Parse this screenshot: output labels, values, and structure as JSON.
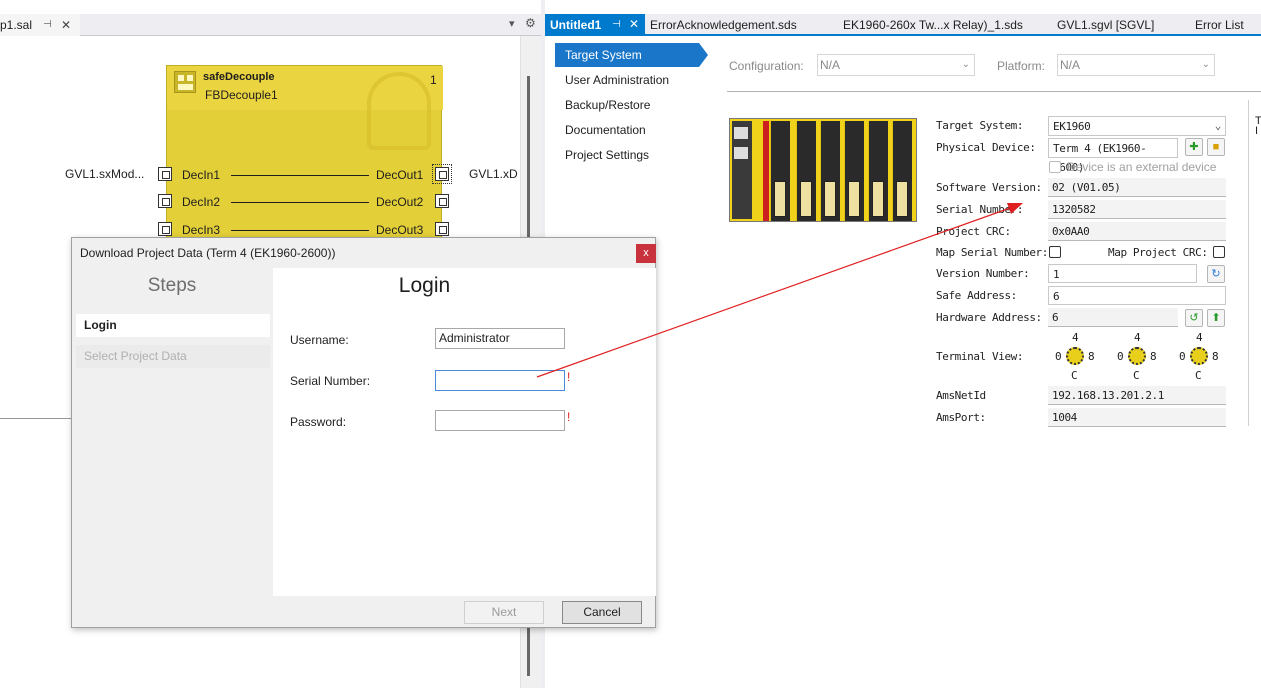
{
  "left_editor": {
    "tab_title": "p1.sal",
    "pin_glyph": "⊣",
    "close_glyph": "✕",
    "dropdown_glyph": "▾",
    "settings_glyph": "⚙",
    "fb_block": {
      "instance_name": "safeDecouple",
      "type_name": "FBDecouple1",
      "order_number": "1",
      "inputs": [
        "DecIn1",
        "DecIn2",
        "DecIn3"
      ],
      "outputs": [
        "DecOut1",
        "DecOut2",
        "DecOut3"
      ],
      "input_variable": "GVL1.sxMod...",
      "output_variable": "GVL1.xD"
    }
  },
  "right_panel": {
    "tabs": [
      {
        "label": "Untitled1",
        "active": true
      },
      {
        "label": "ErrorAcknowledgement.sds"
      },
      {
        "label": "EK1960-260x Tw...x Relay)_1.sds"
      },
      {
        "label": "GVL1.sgvl [SGVL]"
      },
      {
        "label": "Error List"
      }
    ],
    "active_tab_pin": "⊣",
    "active_tab_close": "✕",
    "nav": [
      "Target System",
      "User Administration",
      "Backup/Restore",
      "Documentation",
      "Project Settings"
    ],
    "configuration": {
      "label": "Configuration:",
      "value": "N/A"
    },
    "platform": {
      "label": "Platform:",
      "value": "N/A"
    },
    "properties": {
      "target_system": {
        "label": "Target System:",
        "value": "EK1960"
      },
      "physical_device": {
        "label": "Physical Device:",
        "value": "Term 4 (EK1960-2600)"
      },
      "external_device": {
        "label": "Device is an external device"
      },
      "software_version": {
        "label": "Software Version:",
        "value": "02 (V01.05)"
      },
      "serial_number": {
        "label": "Serial Number:",
        "value": "1320582"
      },
      "project_crc": {
        "label": "Project CRC:",
        "value": "0x0AA0"
      },
      "map_serial_number": {
        "label": "Map Serial Number:"
      },
      "map_project_crc": {
        "label": "Map Project CRC:"
      },
      "version_number": {
        "label": "Version Number:",
        "value": "1"
      },
      "safe_address": {
        "label": "Safe Address:",
        "value": "6"
      },
      "hardware_address": {
        "label": "Hardware Address:",
        "value": "6"
      },
      "terminal_view": {
        "label": "Terminal View:"
      },
      "ams_net_id": {
        "label": "AmsNetId",
        "value": "192.168.13.201.2.1"
      },
      "ams_port": {
        "label": "AmsPort:",
        "value": "1004"
      }
    },
    "dial_labels": {
      "top": "4",
      "left": "0",
      "right": "8",
      "bottom": "C"
    },
    "edge_text": "T\nI"
  },
  "dialog": {
    "title": "Download Project Data (Term 4 (EK1960-2600))",
    "close_label": "x",
    "steps_heading": "Steps",
    "steps": [
      {
        "label": "Login",
        "active": true
      },
      {
        "label": "Select Project Data",
        "active": false
      }
    ],
    "page_heading": "Login",
    "username": {
      "label": "Username:",
      "value": "Administrator"
    },
    "serial_number": {
      "label": "Serial Number:",
      "value": "",
      "required_mark": "!"
    },
    "password": {
      "label": "Password:",
      "value": "",
      "required_mark": "!"
    },
    "next_label": "Next",
    "cancel_label": "Cancel"
  },
  "colors": {
    "accent_blue": "#007acc",
    "fb_yellow": "#e3cf38",
    "annotation_red": "#e02020",
    "close_red": "#c8323c"
  }
}
